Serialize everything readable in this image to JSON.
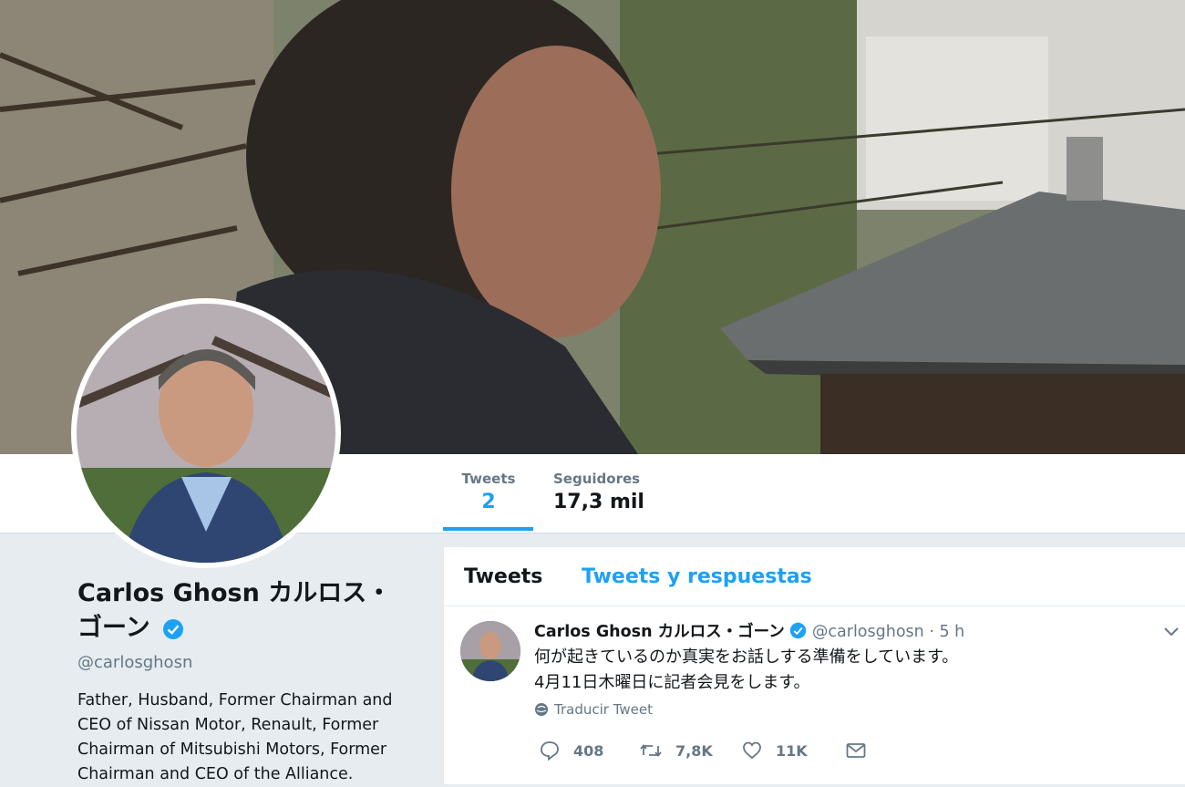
{
  "nav": {
    "stats": [
      {
        "label": "Tweets",
        "value": "2"
      },
      {
        "label": "Seguidores",
        "value": "17,3 mil"
      }
    ]
  },
  "profile": {
    "name": "Carlos Ghosn カルロス・ゴーン",
    "handle": "@carlosghosn",
    "bio": "Father, Husband, Former Chairman and CEO of Nissan Motor, Renault, Former Chairman of Mitsubishi Motors, Former Chairman and CEO of the Alliance."
  },
  "timeline": {
    "tabs": [
      {
        "label": "Tweets"
      },
      {
        "label": "Tweets y respuestas"
      }
    ],
    "tweet": {
      "author": "Carlos Ghosn カルロス・ゴーン",
      "handle": "@carlosghosn",
      "separator": "·",
      "time": "5 h",
      "lines": [
        "何が起きているのか真実をお話しする準備をしています。",
        "4月11日木曜日に記者会見をします。"
      ],
      "translate": "Traducir Tweet",
      "actions": {
        "replies": "408",
        "retweets": "7,8K",
        "likes": "11K"
      }
    }
  },
  "colors": {
    "accent": "#1da1f2",
    "muted": "#657786",
    "background": "#e6ecf0"
  },
  "icons": [
    "verified-badge-icon",
    "chevron-down-icon",
    "globe-icon",
    "reply-icon",
    "retweet-icon",
    "like-icon",
    "direct-message-icon"
  ]
}
